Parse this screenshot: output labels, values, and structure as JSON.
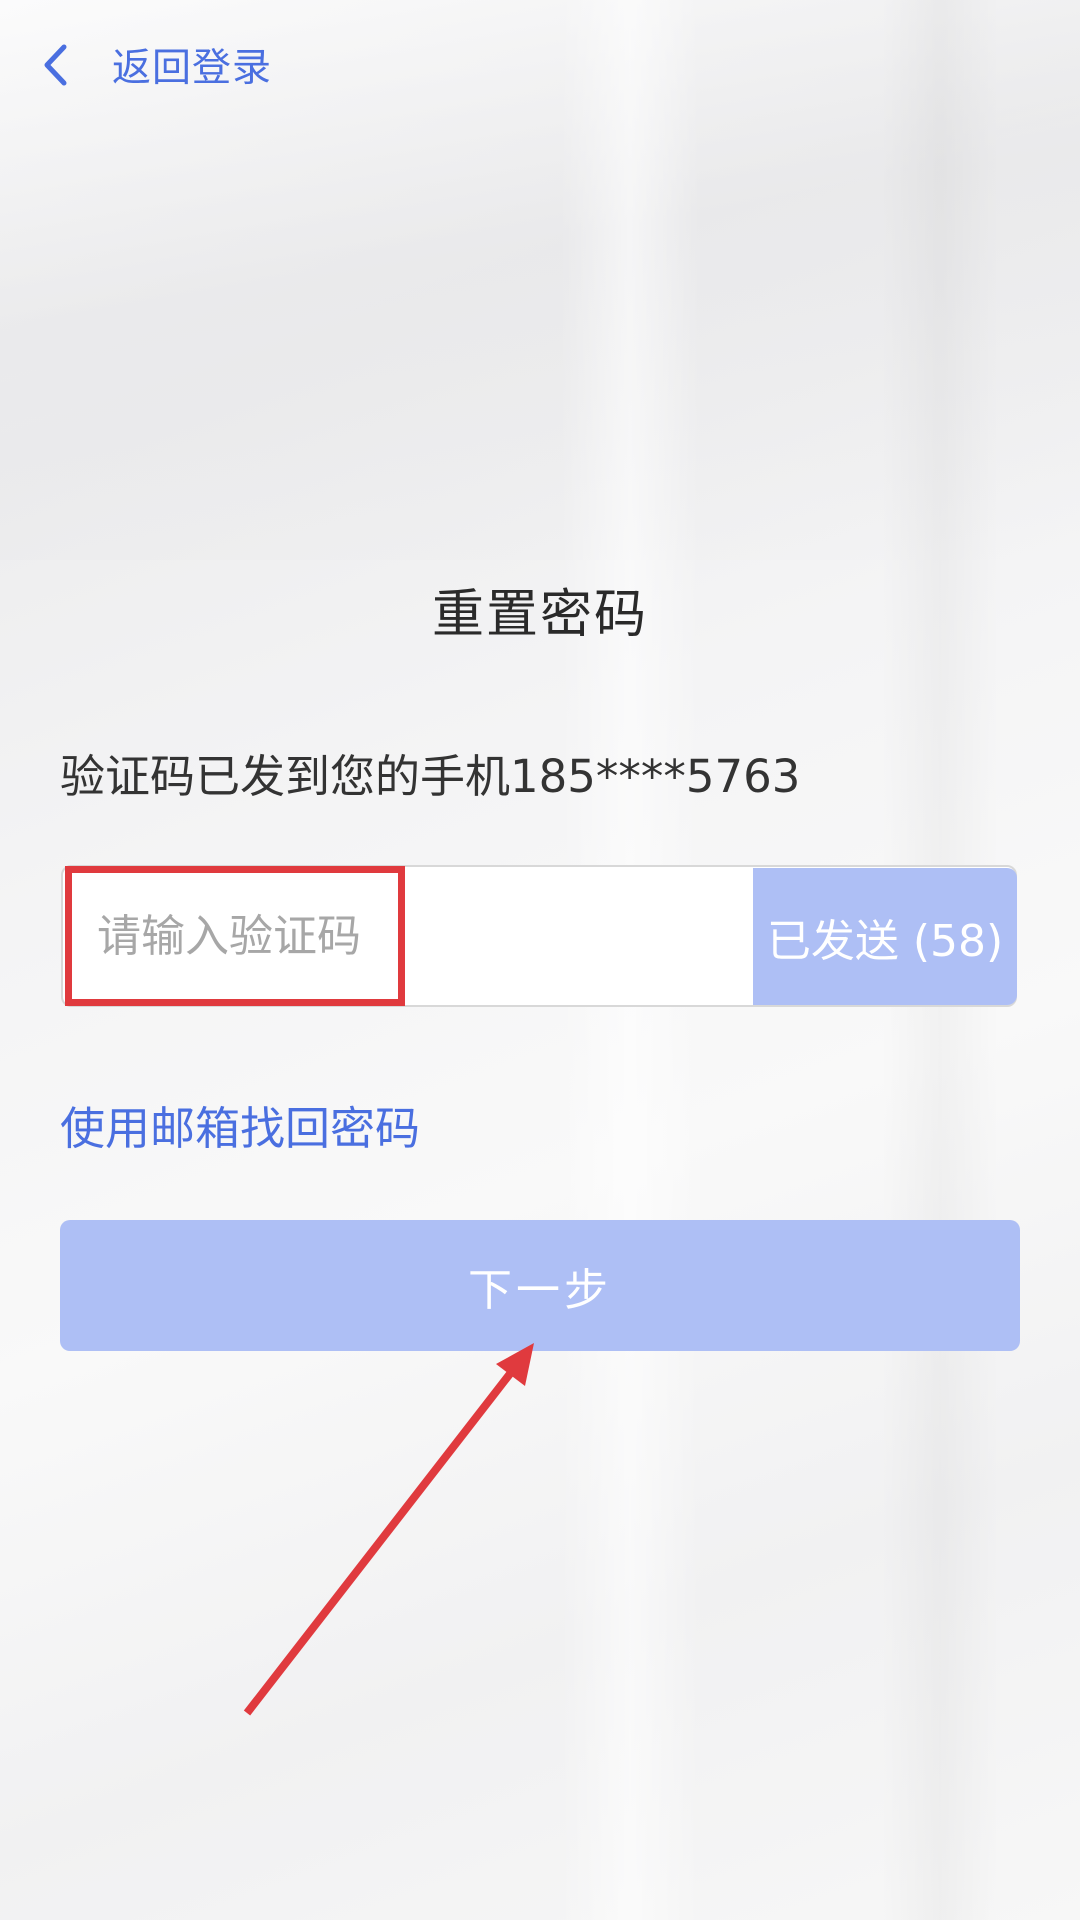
{
  "header": {
    "back_label": "返回登录"
  },
  "page": {
    "title": "重置密码",
    "hint": "验证码已发到您的手机185****5763"
  },
  "code_input": {
    "placeholder": "请输入验证码",
    "value": ""
  },
  "send_button": {
    "label": "已发送 (58)"
  },
  "email_link": {
    "label": "使用邮箱找回密码"
  },
  "next_button": {
    "label": "下一步"
  },
  "colors": {
    "accent": "#4a6fe0",
    "button_disabled": "#aebff5",
    "annotation": "#e03a3e"
  },
  "icons": {
    "back": "chevron-left-icon"
  }
}
